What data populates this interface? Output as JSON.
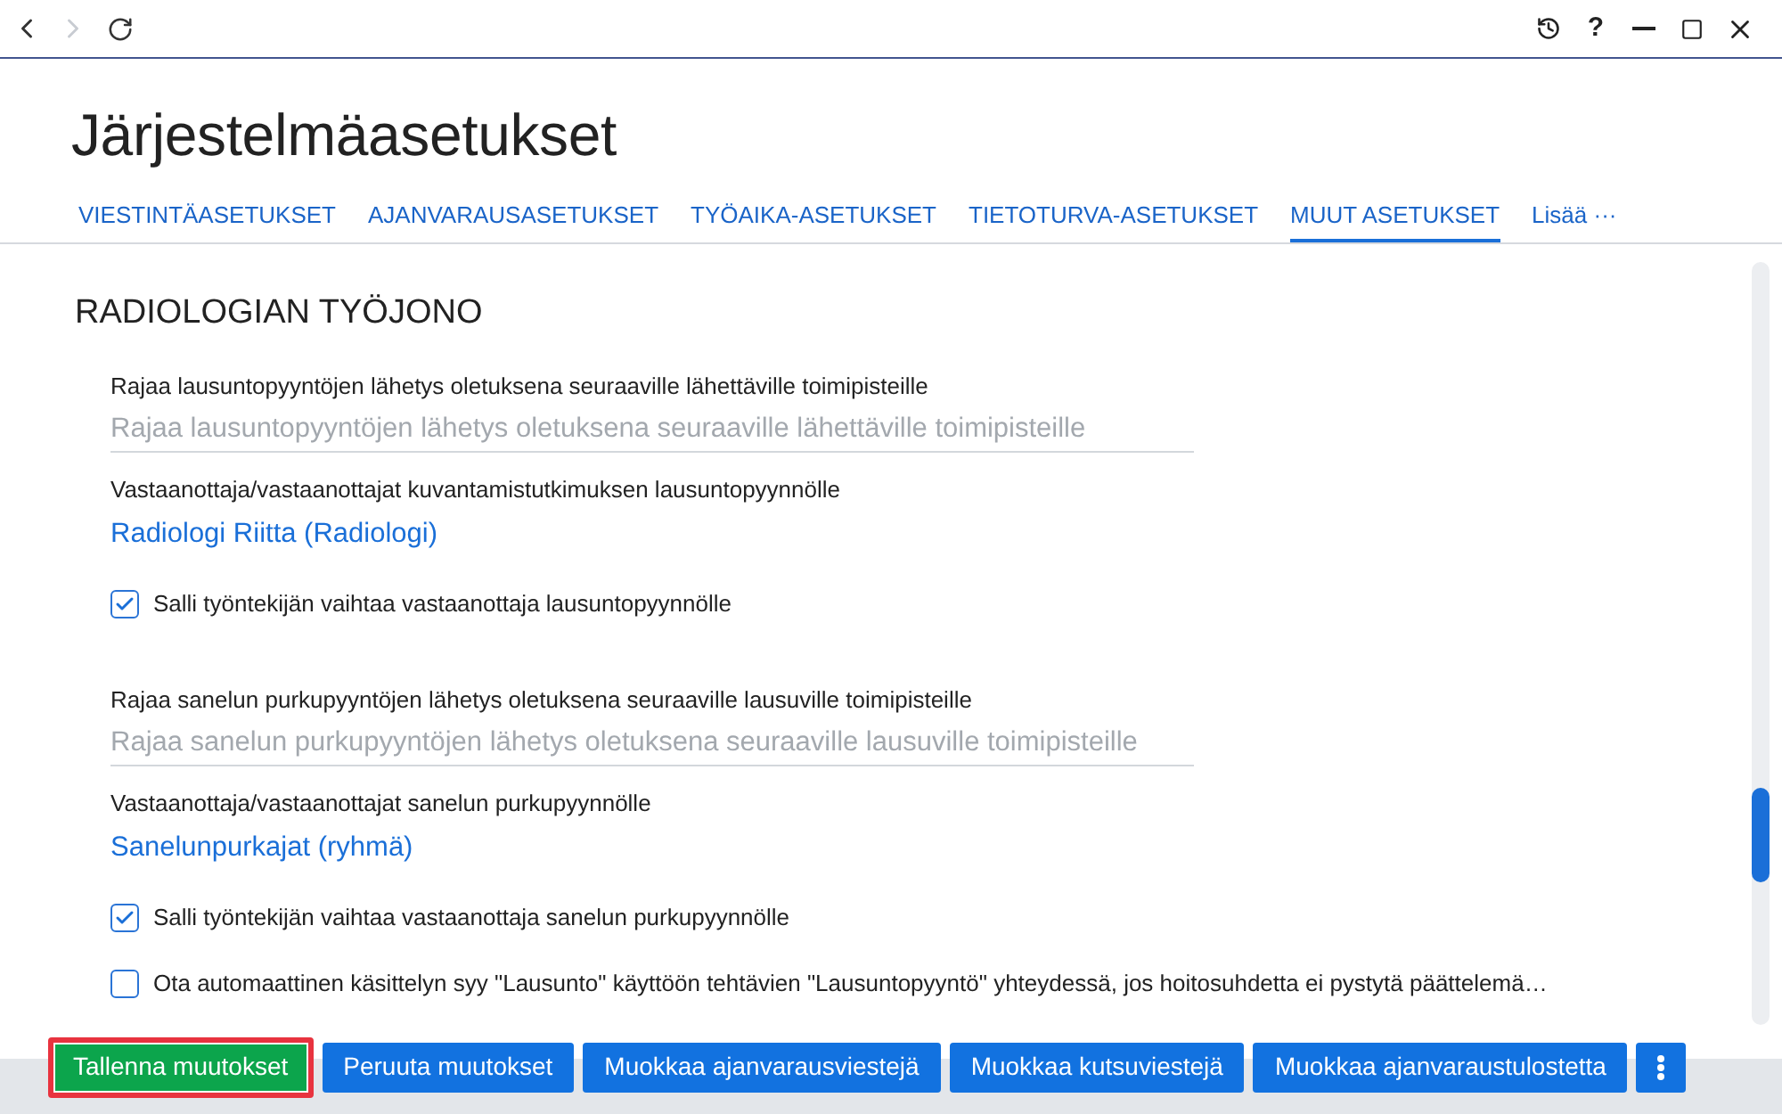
{
  "window": {
    "nav_buttons": [
      {
        "kind": "back",
        "disabled": false
      },
      {
        "kind": "forward",
        "disabled": true
      },
      {
        "kind": "refresh",
        "disabled": false
      }
    ],
    "tools": [
      {
        "kind": "history"
      },
      {
        "kind": "help",
        "label": "?"
      },
      {
        "kind": "minimize"
      },
      {
        "kind": "maximize"
      },
      {
        "kind": "close"
      }
    ]
  },
  "title": "Järjestelmäasetukset",
  "tabs": [
    {
      "label": "VIESTINTÄASETUKSET",
      "selected": false
    },
    {
      "label": "AJANVARAUSASETUKSET",
      "selected": false
    },
    {
      "label": "TYÖAIKA-ASETUKSET",
      "selected": false
    },
    {
      "label": "TIETOTURVA-ASETUKSET",
      "selected": false
    },
    {
      "label": "MUUT ASETUKSET",
      "selected": true
    }
  ],
  "more_tab": {
    "label": "Lisää ···"
  },
  "section": {
    "heading": "RADIOLOGIAN TYÖJONO",
    "groups": [
      {
        "items": [
          {
            "kind": "field",
            "label": "Rajaa lausuntopyyntöjen lähetys oletuksena seuraaville lähettäville toimipisteille",
            "placeholder": "Rajaa lausuntopyyntöjen lähetys oletuksena seuraaville lähettäville toimipisteille"
          },
          {
            "kind": "link",
            "label": "Vastaanottaja/vastaanottajat kuvantamistutkimuksen lausuntopyynnölle",
            "value": "Radiologi Riitta (Radiologi)"
          },
          {
            "kind": "checkbox",
            "label": "Salli työntekijän vaihtaa vastaanottaja lausuntopyynnölle",
            "checked": true
          }
        ]
      },
      {
        "items": [
          {
            "kind": "field",
            "label": "Rajaa sanelun purkupyyntöjen lähetys oletuksena seuraaville lausuville toimipisteille",
            "placeholder": "Rajaa sanelun purkupyyntöjen lähetys oletuksena seuraaville lausuville toimipisteille"
          },
          {
            "kind": "link",
            "label": "Vastaanottaja/vastaanottajat sanelun purkupyynnölle",
            "value": "Sanelunpurkajat (ryhmä)"
          },
          {
            "kind": "checkbox",
            "label": "Salli työntekijän vaihtaa vastaanottaja sanelun purkupyynnölle",
            "checked": true
          },
          {
            "kind": "checkbox",
            "label": "Ota automaattinen käsittelyn syy \"Lausunto\" käyttöön tehtävien \"Lausuntopyyntö\" yhteydessä, jos hoitosuhdetta ei pystytä päättelemä…",
            "checked": false
          }
        ]
      }
    ]
  },
  "footer_buttons": [
    {
      "kind": "save",
      "label": "Tallenna muutokset",
      "focused": true
    },
    {
      "kind": "action",
      "label": "Peruuta muutokset",
      "focused": false
    },
    {
      "kind": "action",
      "label": "Muokkaa ajanvarausviestejä",
      "focused": false
    },
    {
      "kind": "action",
      "label": "Muokkaa kutsuviestejä",
      "focused": false
    },
    {
      "kind": "action",
      "label": "Muokkaa ajanvaraustulostetta",
      "focused": false
    },
    {
      "kind": "menu",
      "focused": false
    }
  ]
}
